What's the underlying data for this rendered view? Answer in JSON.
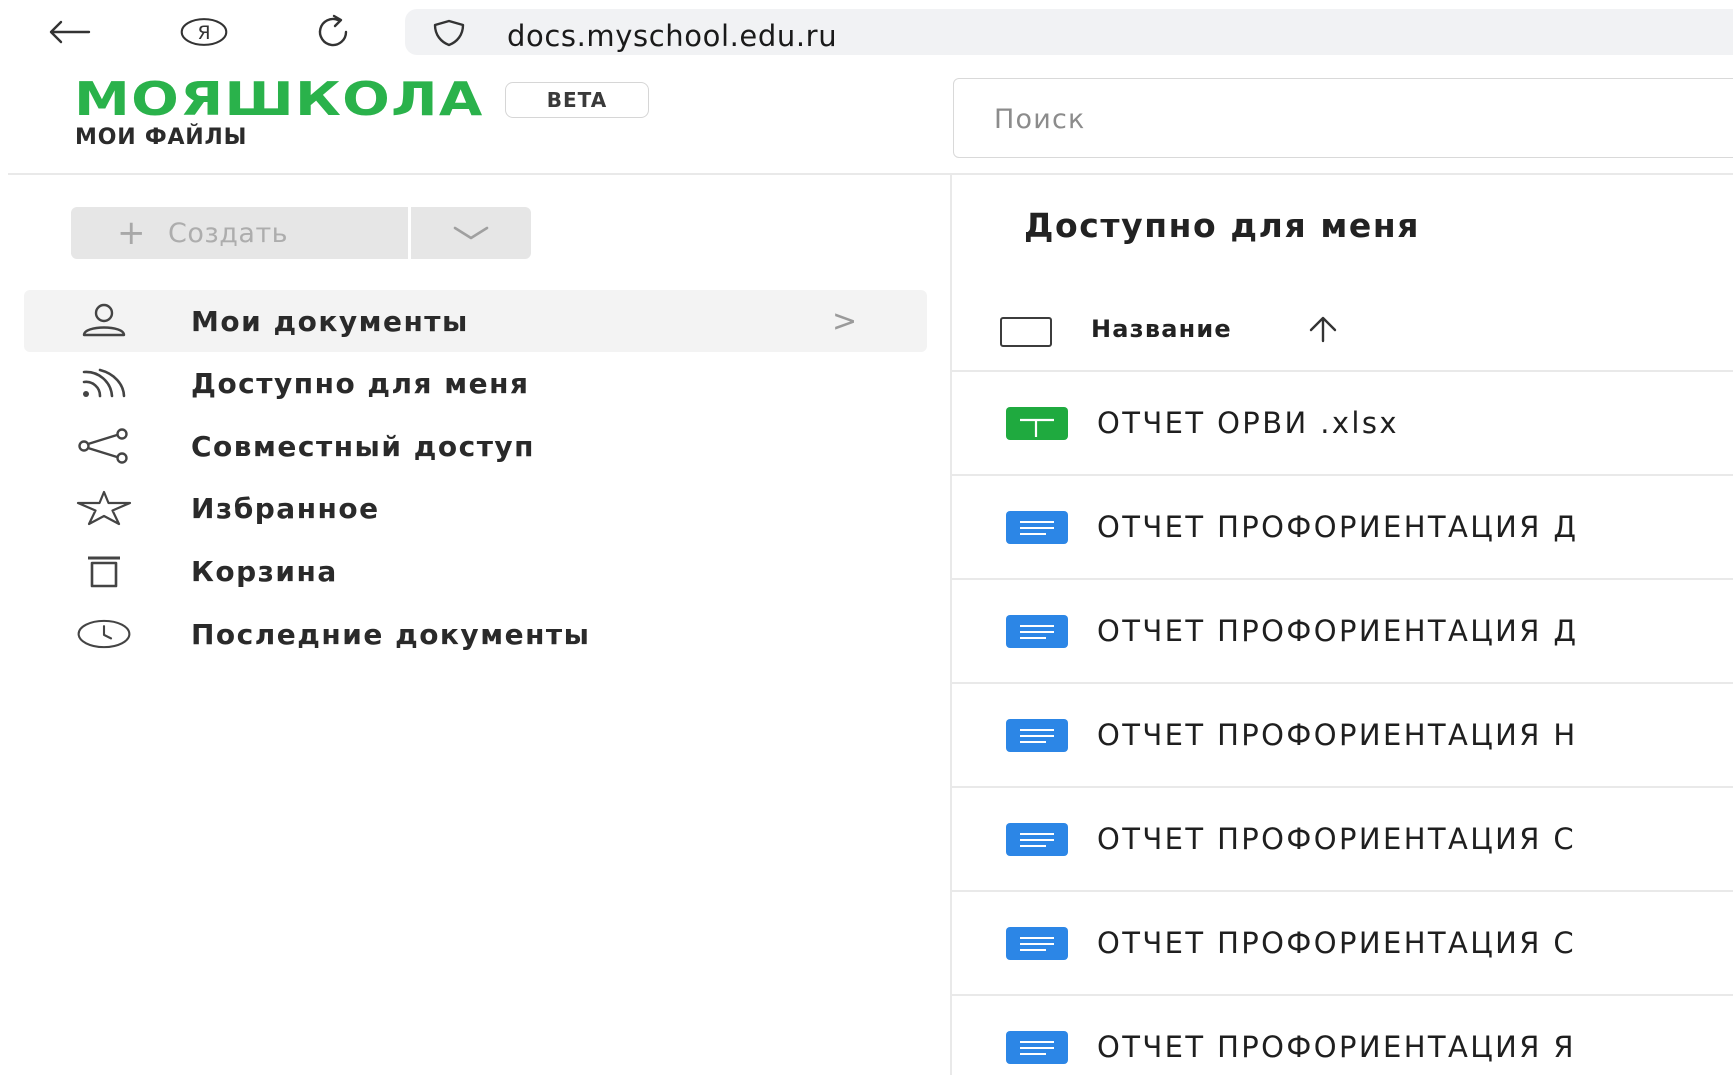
{
  "browser": {
    "url": "docs.myschool.edu.ru",
    "yandex_glyph": "Я"
  },
  "header": {
    "logo": "МОЯШКОЛА",
    "badge": "BETA",
    "subtitle": "МОИ ФАЙЛЫ",
    "search_placeholder": "Поиск"
  },
  "sidebar": {
    "create_label": "Создать",
    "items": [
      {
        "label": "Мои документы",
        "icon": "user-icon",
        "active": true
      },
      {
        "label": "Доступно для меня",
        "icon": "feed-icon",
        "active": false
      },
      {
        "label": "Совместный доступ",
        "icon": "share-icon",
        "active": false
      },
      {
        "label": "Избранное",
        "icon": "star-icon",
        "active": false
      },
      {
        "label": "Корзина",
        "icon": "trash-icon",
        "active": false
      },
      {
        "label": "Последние документы",
        "icon": "clock-icon",
        "active": false
      }
    ],
    "chevron": ">"
  },
  "main": {
    "title": "Доступно для меня",
    "column_name": "Название",
    "files": [
      {
        "name": "ОТЧЕТ ОРВИ .xlsx",
        "type": "xlsx"
      },
      {
        "name": "ОТЧЕТ ПРОФОРИЕНТАЦИЯ Д",
        "type": "doc"
      },
      {
        "name": "ОТЧЕТ ПРОФОРИЕНТАЦИЯ Д",
        "type": "doc"
      },
      {
        "name": "ОТЧЕТ ПРОФОРИЕНТАЦИЯ Н",
        "type": "doc"
      },
      {
        "name": "ОТЧЕТ ПРОФОРИЕНТАЦИЯ С",
        "type": "doc"
      },
      {
        "name": "ОТЧЕТ ПРОФОРИЕНТАЦИЯ С",
        "type": "doc"
      },
      {
        "name": "ОТЧЕТ ПРОФОРИЕНТАЦИЯ Я",
        "type": "doc"
      }
    ]
  },
  "colors": {
    "brand_green": "#2ab24b",
    "xlsx_green": "#1faa3f",
    "doc_blue": "#2c86e6"
  }
}
